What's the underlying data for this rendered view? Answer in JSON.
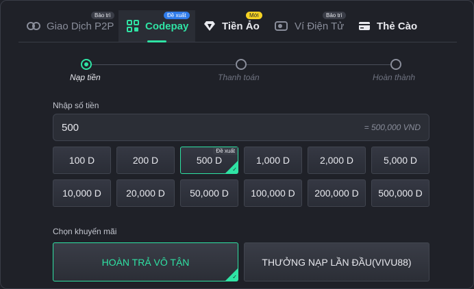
{
  "tabs": [
    {
      "label": "Giao Dịch P2P",
      "badge": "Bảo trì",
      "icon": "p2p-exchange-icon"
    },
    {
      "label": "Codepay",
      "badge": "Đề xuất",
      "icon": "codepay-icon"
    },
    {
      "label": "Tiền Ảo",
      "badge": "Mới",
      "icon": "crypto-diamond-icon"
    },
    {
      "label": "Ví Điện Tử",
      "badge": "Bảo trì",
      "icon": "e-wallet-icon"
    },
    {
      "label": "Thẻ Cào",
      "badge": "",
      "icon": "card-icon"
    }
  ],
  "steps": [
    {
      "label": "Nạp tiền"
    },
    {
      "label": "Thanh toán"
    },
    {
      "label": "Hoàn thành"
    }
  ],
  "amount": {
    "label": "Nhập số tiền",
    "value": "500",
    "conversion": "= 500,000 VND"
  },
  "chips": [
    {
      "label": "100 D"
    },
    {
      "label": "200 D"
    },
    {
      "label": "500 D",
      "badge": "Đề xuất"
    },
    {
      "label": "1,000 D"
    },
    {
      "label": "2,000 D"
    },
    {
      "label": "5,000 D"
    },
    {
      "label": "10,000 D"
    },
    {
      "label": "20,000 D"
    },
    {
      "label": "50,000 D"
    },
    {
      "label": "100,000 D"
    },
    {
      "label": "200,000 D"
    },
    {
      "label": "500,000 D"
    }
  ],
  "promotion": {
    "label": "Chọn khuyến mãi",
    "options": [
      {
        "label": "HOÀN TRẢ VÔ TẬN"
      },
      {
        "label": "THƯỞNG NẠP LẦN ĐẦU(VIVU88)"
      }
    ]
  },
  "colors": {
    "accent": "#2fe3a4",
    "background": "#1f2128",
    "badge_blue": "#2f7bea",
    "badge_yellow": "#f5d224"
  }
}
